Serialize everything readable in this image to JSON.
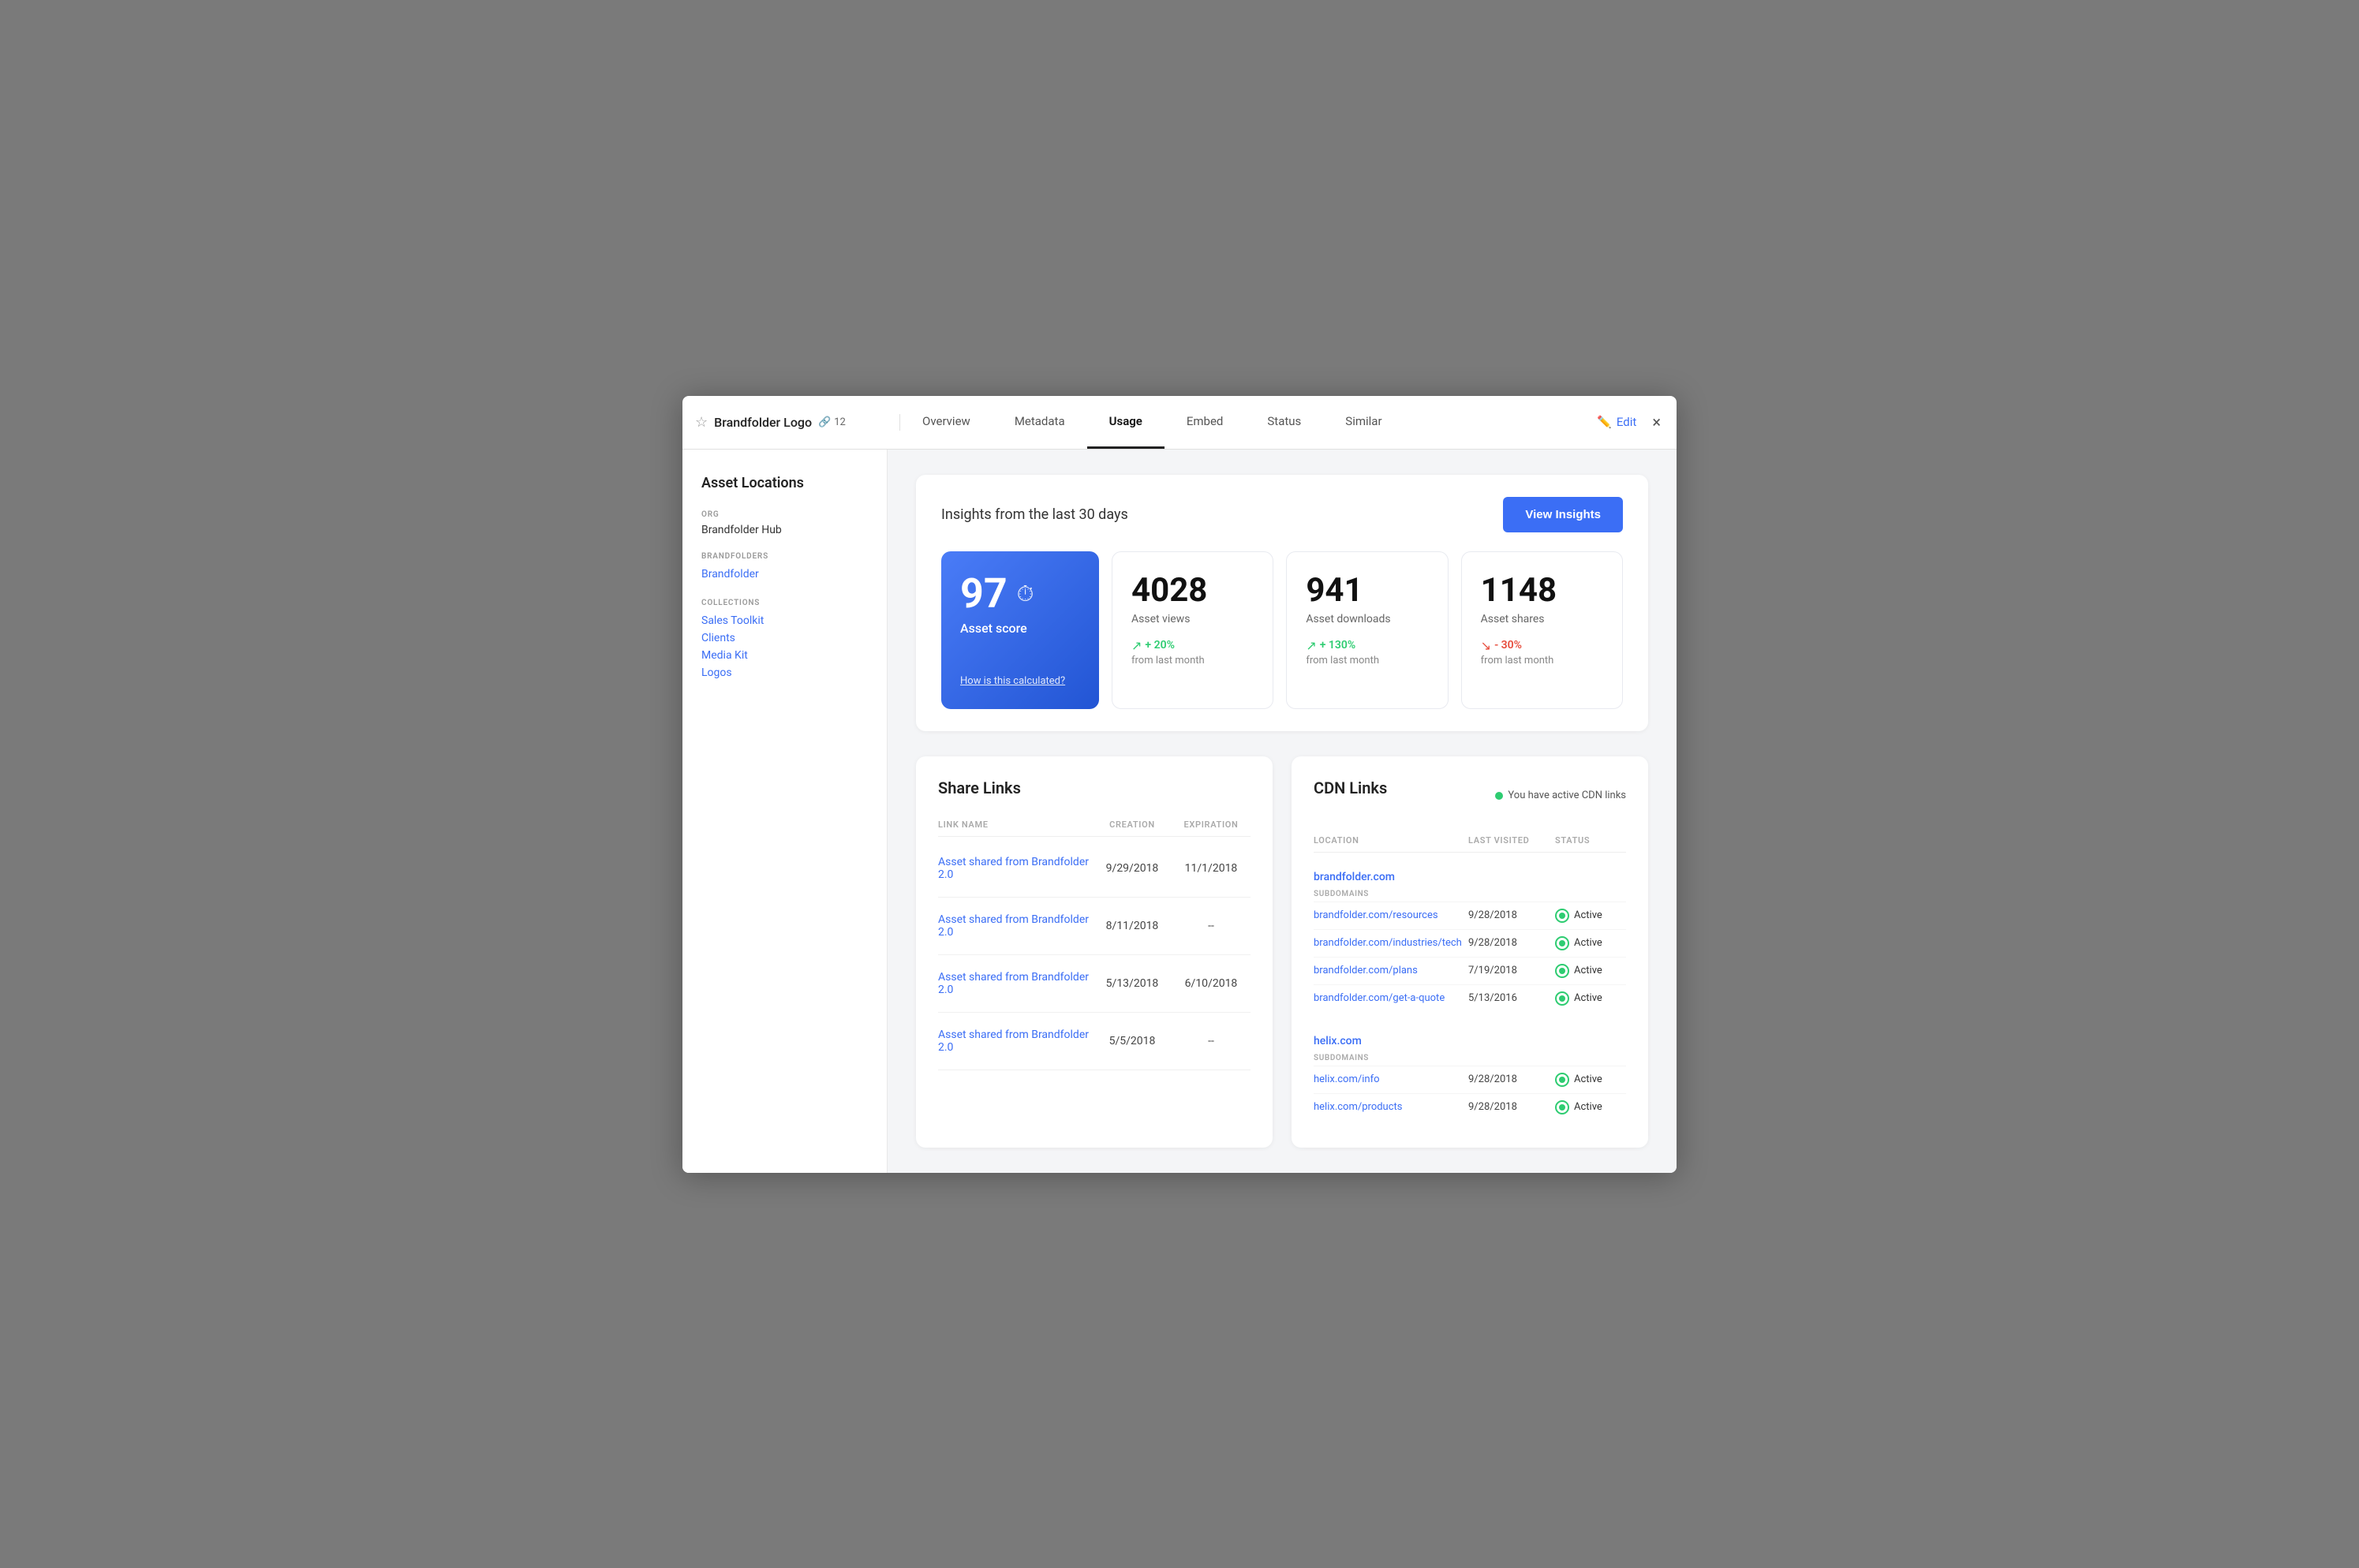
{
  "header": {
    "title": "Brandfolder Logo",
    "link_count": "12",
    "tabs": [
      {
        "label": "Overview",
        "active": false
      },
      {
        "label": "Metadata",
        "active": false
      },
      {
        "label": "Usage",
        "active": true
      },
      {
        "label": "Embed",
        "active": false
      },
      {
        "label": "Status",
        "active": false
      },
      {
        "label": "Similar",
        "active": false
      }
    ],
    "edit_label": "Edit",
    "close_label": "×"
  },
  "sidebar": {
    "title": "Asset Locations",
    "org_label": "ORG",
    "org_name": "Brandfolder Hub",
    "brandfolders_label": "BRANDFOLDERS",
    "brandfolder_link": "Brandfolder",
    "collections_label": "COLLECTIONS",
    "collections": [
      {
        "label": "Sales Toolkit"
      },
      {
        "label": "Clients"
      },
      {
        "label": "Media Kit"
      },
      {
        "label": "Logos"
      }
    ]
  },
  "insights": {
    "title": "Insights from the last 30 days",
    "view_button": "View Insights",
    "score": {
      "value": "97",
      "label": "Asset score",
      "calc_link": "How is this calculated?"
    },
    "metrics": [
      {
        "value": "4028",
        "label": "Asset views",
        "change": "+ 20%",
        "change_type": "positive",
        "change_from": "from last month"
      },
      {
        "value": "941",
        "label": "Asset downloads",
        "change": "+ 130%",
        "change_type": "positive",
        "change_from": "from last month"
      },
      {
        "value": "1148",
        "label": "Asset shares",
        "change": "- 30%",
        "change_type": "negative",
        "change_from": "from last month"
      }
    ]
  },
  "share_links": {
    "title": "Share Links",
    "columns": {
      "link_name": "LINK NAME",
      "creation": "CREATION",
      "expiration": "EXPIRATION"
    },
    "rows": [
      {
        "name": "Asset shared from Brandfolder 2.0",
        "creation": "9/29/2018",
        "expiration": "11/1/2018"
      },
      {
        "name": "Asset shared from Brandfolder 2.0",
        "creation": "8/11/2018",
        "expiration": "--"
      },
      {
        "name": "Asset shared from Brandfolder 2.0",
        "creation": "5/13/2018",
        "expiration": "6/10/2018"
      },
      {
        "name": "Asset shared from Brandfolder 2.0",
        "creation": "5/5/2018",
        "expiration": "--"
      }
    ]
  },
  "cdn_links": {
    "title": "CDN Links",
    "active_badge": "You have active CDN links",
    "columns": {
      "location": "LOCATION",
      "last_visited": "LAST VISITED",
      "status": "STATUS"
    },
    "domains": [
      {
        "domain": "brandfolder.com",
        "subdomains_label": "SUBDOMAINS",
        "rows": [
          {
            "url": "brandfolder.com/resources",
            "last_visited": "9/28/2018",
            "status": "Active"
          },
          {
            "url": "brandfolder.com/industries/tech",
            "last_visited": "9/28/2018",
            "status": "Active"
          },
          {
            "url": "brandfolder.com/plans",
            "last_visited": "7/19/2018",
            "status": "Active"
          },
          {
            "url": "brandfolder.com/get-a-quote",
            "last_visited": "5/13/2016",
            "status": "Active"
          }
        ]
      },
      {
        "domain": "helix.com",
        "subdomains_label": "SUBDOMAINS",
        "rows": [
          {
            "url": "helix.com/info",
            "last_visited": "9/28/2018",
            "status": "Active"
          },
          {
            "url": "helix.com/products",
            "last_visited": "9/28/2018",
            "status": "Active"
          }
        ]
      }
    ]
  }
}
